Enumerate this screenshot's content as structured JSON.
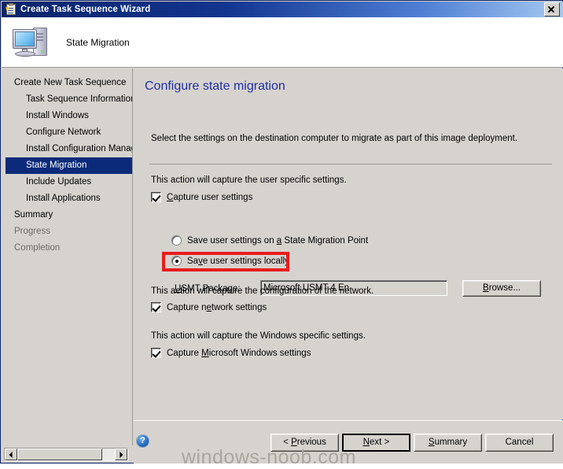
{
  "window": {
    "title": "Create Task Sequence Wizard",
    "title_icon": "task-sequence-icon",
    "close_label": "Close",
    "accent_title_color": "#0a246a"
  },
  "header": {
    "title": "State Migration",
    "icon": "computer-icon"
  },
  "sidebar": {
    "items": [
      {
        "label": "Create New Task Sequence",
        "level": 0,
        "selected": false,
        "dim": false
      },
      {
        "label": "Task Sequence Information",
        "level": 1,
        "selected": false,
        "dim": false
      },
      {
        "label": "Install Windows",
        "level": 1,
        "selected": false,
        "dim": false
      },
      {
        "label": "Configure Network",
        "level": 1,
        "selected": false,
        "dim": false
      },
      {
        "label": "Install Configuration Manag",
        "level": 1,
        "selected": false,
        "dim": false
      },
      {
        "label": "State Migration",
        "level": 1,
        "selected": true,
        "dim": false
      },
      {
        "label": "Include Updates",
        "level": 1,
        "selected": false,
        "dim": false
      },
      {
        "label": "Install Applications",
        "level": 1,
        "selected": false,
        "dim": false
      },
      {
        "label": "Summary",
        "level": 0,
        "selected": false,
        "dim": false
      },
      {
        "label": "Progress",
        "level": 0,
        "selected": false,
        "dim": true
      },
      {
        "label": "Completion",
        "level": 0,
        "selected": false,
        "dim": true
      }
    ],
    "selected_bg": "#0b2a7a",
    "scrollbar": {
      "left_arrow": "scroll-left-icon",
      "right_arrow": "scroll-right-icon"
    }
  },
  "main": {
    "page_title": "Configure state migration",
    "page_title_color": "#1f2fa0",
    "intro": "Select the settings on the destination computer to migrate as part of this image deployment.",
    "user_section": {
      "description": "This action will capture the user specific settings.",
      "capture_user_settings": {
        "label_pre": "C",
        "label_acc": "C",
        "label_full": "Capture user settings",
        "label_rest": "apture user settings",
        "checked": true
      },
      "usmt": {
        "label_acc": "U",
        "label_rest": "SMT Package:",
        "value": "Microsoft USMT 4 En",
        "browse_acc": "B",
        "browse_rest": "rowse..."
      },
      "radio_smp": {
        "text_before": "Save user settings on ",
        "acc": "a",
        "text_after": " State Migration Point",
        "selected": false
      },
      "radio_local": {
        "text_before": "Sa",
        "acc": "v",
        "text_after": "e user settings locally",
        "selected": true,
        "highlighted": true,
        "highlight_color": "#e81c1c"
      }
    },
    "network_section": {
      "description": "This action will capture the configuration of the network.",
      "checkbox": {
        "text_before": "Capture n",
        "acc": "e",
        "text_after": "twork settings",
        "checked": true
      }
    },
    "windows_section": {
      "description": "This action will capture the Windows specific settings.",
      "checkbox": {
        "text_before": "Capture ",
        "acc": "M",
        "text_after": "icrosoft Windows settings",
        "checked": true
      }
    }
  },
  "footer": {
    "help_icon": "help-icon",
    "help_glyph": "?",
    "buttons": {
      "previous": {
        "before": "< ",
        "acc": "P",
        "after": "revious"
      },
      "next": {
        "before": "",
        "acc": "N",
        "after": "ext >",
        "is_default": true
      },
      "summary": {
        "before": "",
        "acc": "S",
        "after": "ummary"
      },
      "cancel": {
        "before": "",
        "acc": "",
        "after": "Cancel"
      }
    }
  },
  "watermark": {
    "text": "windows-noob.com"
  }
}
